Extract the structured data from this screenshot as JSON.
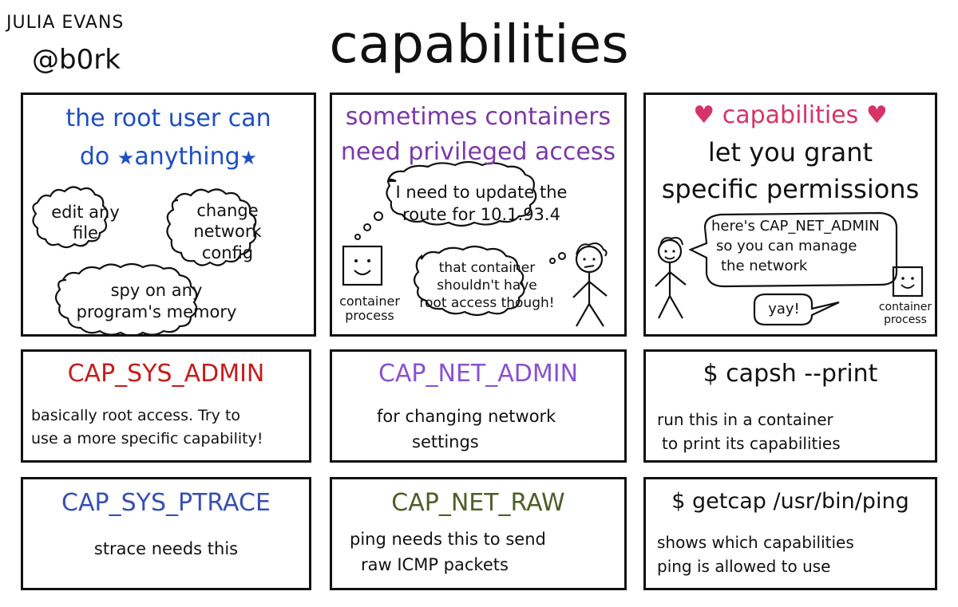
{
  "header": {
    "author": "JULIA EVANS",
    "handle": "@b0rk",
    "title": "capabilities"
  },
  "colors": {
    "blue": "#1f4fc2",
    "purple": "#7a3aa8",
    "pink": "#d63466",
    "red": "#c41e1e",
    "lavender": "#8a52d0",
    "indigo": "#3a4fb2",
    "olive": "#4e5e2a",
    "ink": "#111111"
  },
  "panels": {
    "root": {
      "line1": "the root user can",
      "line2_do": "do",
      "line2_star_left": "★",
      "line2_anything": "anything",
      "line2_star_right": "★",
      "bubble_edit_1": "edit any",
      "bubble_edit_2": "file",
      "bubble_change_1": "change",
      "bubble_change_2": "network",
      "bubble_change_3": "config",
      "bubble_spy_1": "spy on any",
      "bubble_spy_2": "program's memory"
    },
    "privileged": {
      "line1": "sometimes containers",
      "line2": "need privileged access",
      "bubble_update_1": "I need to update the",
      "bubble_update_2": "route for 10.1.93.4",
      "bubble_warn_1": "that container",
      "bubble_warn_2": "shouldn't have",
      "bubble_warn_3": "root access though!",
      "label_1": "container",
      "label_2": "process"
    },
    "grant": {
      "heart_left": "♥",
      "title": "capabilities",
      "heart_right": "♥",
      "line2": "let you grant",
      "line3": "specific permissions",
      "bubble_1": "here's CAP_NET_ADMIN",
      "bubble_2": "so you can manage",
      "bubble_3": "the network",
      "yay": "yay!",
      "label_1": "container",
      "label_2": "process"
    },
    "sys_admin": {
      "heading": "CAP_SYS_ADMIN",
      "line1": "basically root access. Try to",
      "line2": "use a more specific capability!"
    },
    "net_admin": {
      "heading": "CAP_NET_ADMIN",
      "line1": "for changing network",
      "line2": "settings"
    },
    "capsh": {
      "heading": "$ capsh --print",
      "line1": "run this in a container",
      "line2": "to print its capabilities"
    },
    "sys_ptrace": {
      "heading": "CAP_SYS_PTRACE",
      "line1": "strace needs this"
    },
    "net_raw": {
      "heading": "CAP_NET_RAW",
      "line1": "ping needs this to send",
      "line2": "raw ICMP packets"
    },
    "getcap": {
      "heading": "$ getcap /usr/bin/ping",
      "line1": "shows which capabilities",
      "line2": "ping is allowed to use"
    }
  }
}
